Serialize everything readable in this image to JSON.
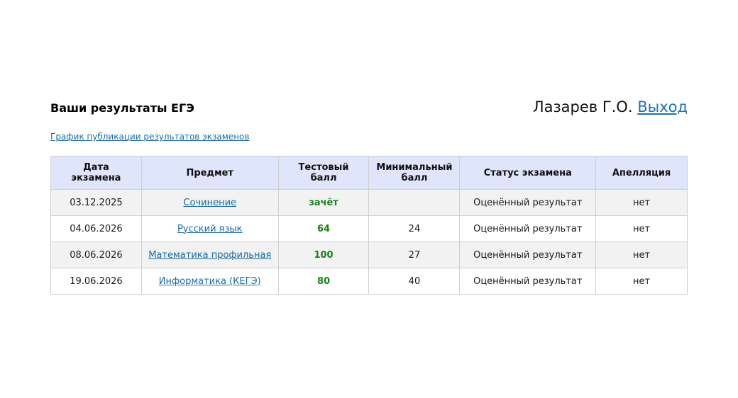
{
  "page": {
    "title": "Ваши результаты ЕГЭ",
    "user_name": "Лазарев Г.О.",
    "logout_label": "Выход",
    "schedule_link": "График публикации результатов экзаменов"
  },
  "table": {
    "headers": {
      "date": "Дата экзамена",
      "subject": "Предмет",
      "test_score": "Тестовый балл",
      "min_score": "Минимальный балл",
      "status": "Статус экзамена",
      "appeal": "Апелляция"
    },
    "rows": [
      {
        "date": "03.12.2025",
        "subject": "Сочинение",
        "score": "зачёт",
        "min": "",
        "status": "Оценённый результат",
        "appeal": "нет"
      },
      {
        "date": "04.06.2026",
        "subject": "Русский язык",
        "score": "64",
        "min": "24",
        "status": "Оценённый результат",
        "appeal": "нет"
      },
      {
        "date": "08.06.2026",
        "subject": "Математика профильная",
        "score": "100",
        "min": "27",
        "status": "Оценённый результат",
        "appeal": "нет"
      },
      {
        "date": "19.06.2026",
        "subject": "Информатика (КЕГЭ)",
        "score": "80",
        "min": "40",
        "status": "Оценённый результат",
        "appeal": "нет"
      }
    ]
  },
  "colors": {
    "header_bg": "#dfe5fb",
    "link": "#1a6aa3",
    "score": "#1a7f1a",
    "odd_row_bg": "#f2f2f2"
  }
}
